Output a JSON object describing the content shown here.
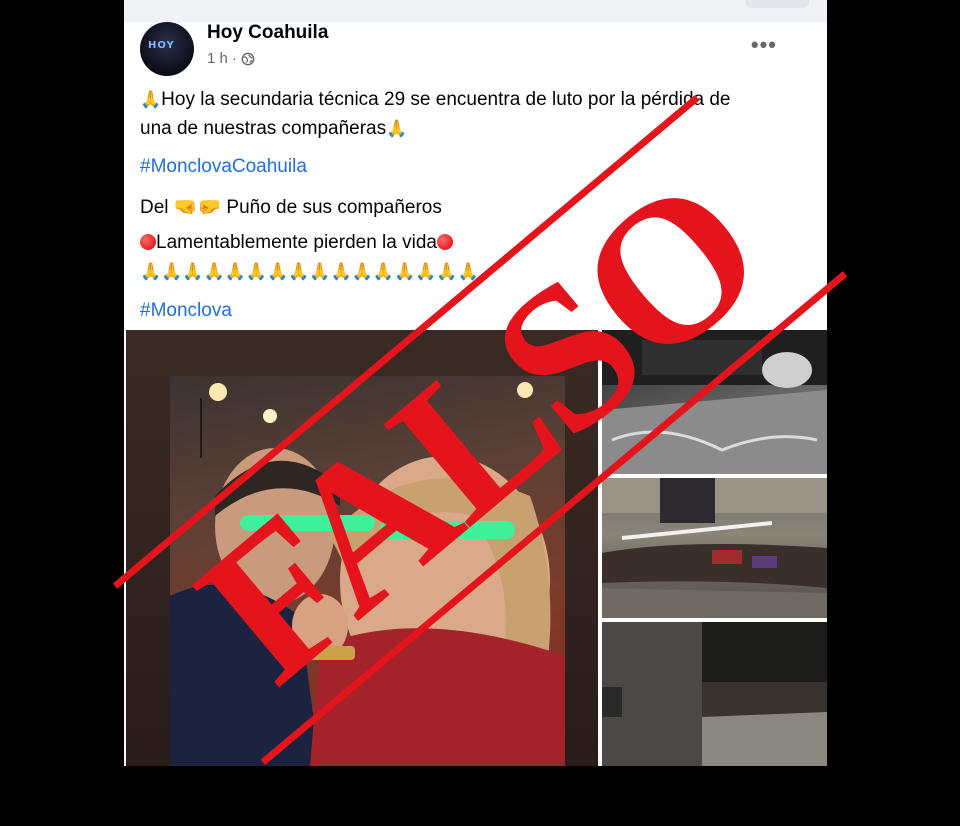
{
  "post": {
    "page_name": "Hoy Coahuila",
    "time": "1 h",
    "visibility_icon": "globe-icon",
    "more_icon": "more-options-icon",
    "avatar_text": "HOY",
    "line1": "Hoy la secundaria técnica 29 se encuentra de luto por la pérdida de",
    "line2": "una de nuestras compañeras",
    "hashtag1": "#MonclovaCoahuila",
    "del_prefix": "Del",
    "del_emoji": "🤜🤛",
    "del_suffix": "Puño de sus compañeros",
    "lamentable": "Lamentablemente pierden la vida",
    "prayers": "🙏🙏🙏🙏🙏🙏🙏🙏🙏🙏🙏🙏🙏🙏🙏🙏",
    "hashtag2": "#Monclova",
    "pray_emoji": "🙏"
  },
  "stamp": {
    "text": "FALSO",
    "color": "#e3141b"
  },
  "colors": {
    "hashtag": "#216fdb",
    "name": "#050505",
    "meta": "#65676b"
  }
}
